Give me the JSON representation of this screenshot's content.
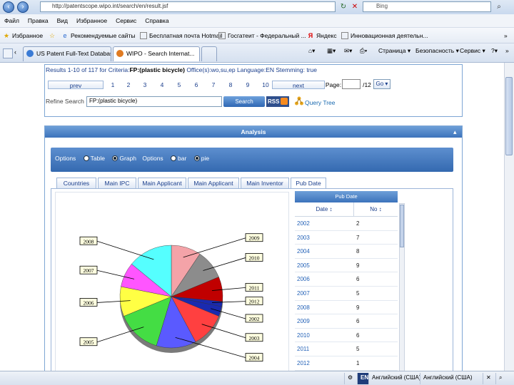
{
  "browser": {
    "url": "http://patentscope.wipo.int/search/en/result.jsf",
    "search_placeholder": "Bing",
    "menu": [
      "Файл",
      "Правка",
      "Вид",
      "Избранное",
      "Сервис",
      "Справка"
    ],
    "favorites_label": "Избранное",
    "favorites": [
      "Рекомендуемые сайты",
      "Бесплатная почта Hotmail",
      "Госгатеит - Федеральный ...",
      "Яндекс",
      "Инновационная деятельн..."
    ],
    "tabs": [
      {
        "title": "US Patent Full-Text Databas...",
        "active": false
      },
      {
        "title": "WIPO - Search Internat...",
        "active": true
      }
    ],
    "commands": [
      "Страница",
      "Безопасность",
      "Сервис"
    ],
    "status": {
      "language1": "Английский (США)",
      "language2": "Английский (США)",
      "en": "EN"
    }
  },
  "results": {
    "prefix": "Results 1-10 of 117 for Criteria:",
    "criteria": "FP:(plastic bicycle)",
    "suffix": " Office(s):wo,su,ep Language:EN Stemming: true",
    "prev": "prev",
    "pages": [
      "1",
      "2",
      "3",
      "4",
      "5",
      "6",
      "7",
      "8",
      "9",
      "10"
    ],
    "next": "next",
    "page_label": "Page:",
    "page_total": "/12",
    "go": "Go",
    "refine_label": "Refine Search",
    "refine_value": "FP:(plastic bicycle)",
    "search_button": "Search",
    "rss": "RSS",
    "query_tree": "Query Tree"
  },
  "analysis": {
    "title": "Analysis",
    "options_label": "Options",
    "view_options": [
      "Table",
      "Graph"
    ],
    "view_selected": "Graph",
    "options_label2": "Options",
    "chart_options": [
      "bar",
      "pie"
    ],
    "chart_selected": "pie",
    "tabs": [
      "Countries",
      "Main IPC",
      "Main Applicant",
      "Main Applicant",
      "Main Inventor",
      "Pub Date"
    ],
    "active_tab": "Pub Date",
    "table": {
      "title": "Pub Date",
      "col_date": "Date ↕",
      "col_no": "No ↕",
      "rows": [
        {
          "date": "2002",
          "no": "2"
        },
        {
          "date": "2003",
          "no": "7"
        },
        {
          "date": "2004",
          "no": "8"
        },
        {
          "date": "2005",
          "no": "9"
        },
        {
          "date": "2006",
          "no": "6"
        },
        {
          "date": "2007",
          "no": "5"
        },
        {
          "date": "2008",
          "no": "9"
        },
        {
          "date": "2009",
          "no": "6"
        },
        {
          "date": "2010",
          "no": "6"
        },
        {
          "date": "2011",
          "no": "5"
        },
        {
          "date": "2012",
          "no": "1"
        }
      ]
    }
  },
  "chart_data": {
    "type": "pie",
    "categories": [
      "2009",
      "2010",
      "2011",
      "2012",
      "2002",
      "2003",
      "2004",
      "2005",
      "2006",
      "2007",
      "2008"
    ],
    "values": [
      6,
      6,
      5,
      1,
      2,
      7,
      8,
      9,
      6,
      5,
      9
    ],
    "colors": [
      "#f4a3a8",
      "#8c8c8c",
      "#c00000",
      "#1a2ab0",
      "#1a2ab0",
      "#ff4040",
      "#5a5aff",
      "#44dd44",
      "#ffff44",
      "#ff55ff",
      "#55ffff"
    ]
  }
}
